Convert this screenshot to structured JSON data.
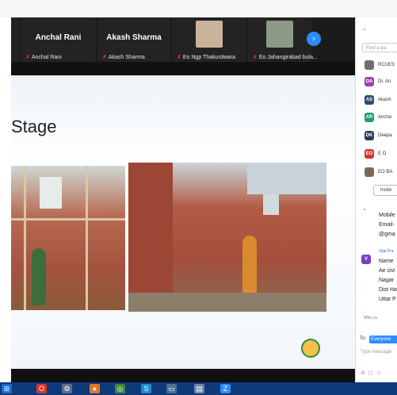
{
  "gallery": {
    "tiles": [
      {
        "big": "",
        "label": "",
        "mic": ""
      },
      {
        "big": "Anchal Rani",
        "label": "Anchal Rani",
        "mic": "✗"
      },
      {
        "big": "Akash Sharma",
        "label": "Akash Sharma",
        "mic": "✗"
      },
      {
        "big": "",
        "label": "Eo Ngp Thakurdwara",
        "mic": "✗"
      },
      {
        "big": "",
        "label": "Eo Jahangirabad bula...",
        "mic": "✗"
      }
    ],
    "next": "›"
  },
  "slide": {
    "title": "Stage"
  },
  "panel": {
    "search_placeholder": "Find a pa",
    "participants": [
      {
        "initials": "",
        "name": "RCUES",
        "color": "#6e6e6e"
      },
      {
        "initials": "DA",
        "name": "Dr. An",
        "color": "#9b3fb5"
      },
      {
        "initials": "AS",
        "name": "Akash",
        "color": "#2f4a6e"
      },
      {
        "initials": "AR",
        "name": "Ancha",
        "color": "#1f9d6a"
      },
      {
        "initials": "DK",
        "name": "Deepa",
        "color": "#2a3d5a"
      },
      {
        "initials": "EO",
        "name": "E O",
        "color": "#d9342b"
      },
      {
        "initials": "",
        "name": "EO BA",
        "color": "#7a6a55"
      }
    ],
    "invite_label": "Invite",
    "chat": {
      "lines1": [
        "Mobile",
        "Email-",
        "@gma"
      ],
      "sender": "Vijai Pra",
      "sender_initial": "V",
      "lines2": [
        "Name",
        "Ae civi",
        "Nagar",
        "Dist Ha",
        "Uttar P"
      ],
      "who_can": "Who ca",
      "to_label": "To:",
      "to_value": "Everyone",
      "type_placeholder": "Type message"
    }
  },
  "taskbar": {
    "items": [
      "⊞",
      "O",
      "⚙",
      "●",
      "◎",
      "S",
      "▭",
      "▤",
      "Z"
    ]
  }
}
